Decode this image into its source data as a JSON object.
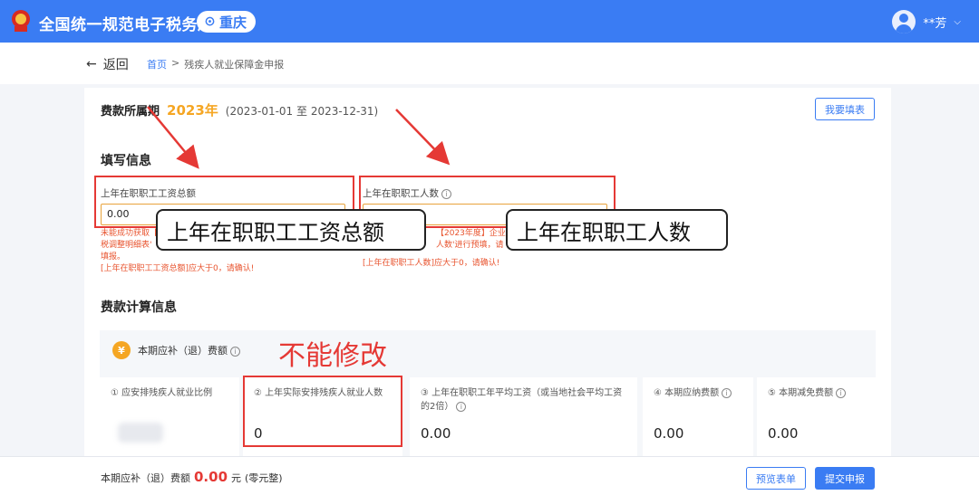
{
  "header": {
    "title": "全国统一规范电子税务局",
    "region": "重庆",
    "user": "**芳"
  },
  "breadcrumb": {
    "back": "返回",
    "home": "首页",
    "sep": ">",
    "current": "残疾人就业保障金申报"
  },
  "period": {
    "label": "费款所属期",
    "year": "2023年",
    "range": "(2023-01-01 至 2023-12-31)",
    "fill_button": "我要填表"
  },
  "fill_section": {
    "title": "填写信息",
    "wage": {
      "label": "上年在职职工工资总额",
      "value": "0.00",
      "error_lines": [
        "未能成功获取【",
        "税调整明细表'",
        "填报。",
        "[上年在职职工工资总额]应大于0，请确认!"
      ]
    },
    "count": {
      "label": "上年在职职工人数",
      "error_lines": [
        "【2023年度】企业所得税",
        "人数'进行预填，请",
        "[上年在职职工人数]应大于0，请确认!"
      ]
    }
  },
  "annotations": {
    "callout_wage": "上年在职职工工资总额",
    "callout_count": "上年在职职工人数",
    "no_edit": "不能修改"
  },
  "calc_section": {
    "title": "费款计算信息",
    "current_label": "本期应补（退）费额",
    "yen_symbol": "¥",
    "cells": [
      {
        "label": "① 应安排残疾人就业比例",
        "value": ""
      },
      {
        "label": "② 上年实际安排残疾人就业人数",
        "value": "0"
      },
      {
        "label": "③ 上年在职职工年平均工资（或当地社会平均工资的2倍）",
        "value": "0.00"
      },
      {
        "label": "④ 本期应纳费额",
        "value": "0.00"
      },
      {
        "label": "⑤ 本期减免费额",
        "value": "0.00"
      }
    ]
  },
  "footer": {
    "label": "本期应补（退）费额",
    "amount": "0.00",
    "unit": "元",
    "words": "(零元整)",
    "preview_button": "预览表单",
    "submit_button": "提交申报"
  },
  "colors": {
    "primary": "#3a7cf3",
    "warning": "#f5a623",
    "error": "#e53935",
    "annotation": "#e53935"
  }
}
